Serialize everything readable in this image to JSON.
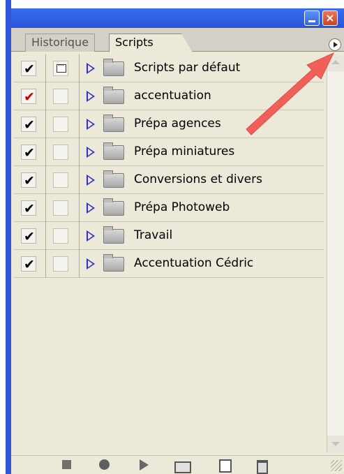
{
  "window": {
    "close_glyph": "×"
  },
  "tabs": [
    {
      "label": "Historique",
      "active": false
    },
    {
      "label": "Scripts",
      "active": true
    }
  ],
  "rows": [
    {
      "label": "Scripts par défaut",
      "checked": true,
      "check_color": "#000000",
      "dialog": true
    },
    {
      "label": "accentuation",
      "checked": true,
      "check_color": "#cc0000",
      "dialog": false
    },
    {
      "label": "Prépa agences",
      "checked": true,
      "check_color": "#000000",
      "dialog": false
    },
    {
      "label": "Prépa miniatures",
      "checked": true,
      "check_color": "#000000",
      "dialog": false
    },
    {
      "label": "Conversions et divers",
      "checked": true,
      "check_color": "#000000",
      "dialog": false
    },
    {
      "label": "Prépa Photoweb",
      "checked": true,
      "check_color": "#000000",
      "dialog": false
    },
    {
      "label": "Travail",
      "checked": true,
      "check_color": "#000000",
      "dialog": false
    },
    {
      "label": "Accentuation Cédric",
      "checked": true,
      "check_color": "#000000",
      "dialog": false
    }
  ],
  "check_glyph": "✔",
  "colors": {
    "title_blue": "#2a55d6",
    "panel_bg": "#ece9d8",
    "arrow_red": "#f0605a",
    "expand_triangle": "#2d33c8"
  },
  "icons": {
    "panel_menu": "panel-menu-icon",
    "bottom": [
      "stop-icon",
      "record-icon",
      "play-icon",
      "new-set-icon",
      "new-script-icon",
      "trash-icon"
    ]
  }
}
